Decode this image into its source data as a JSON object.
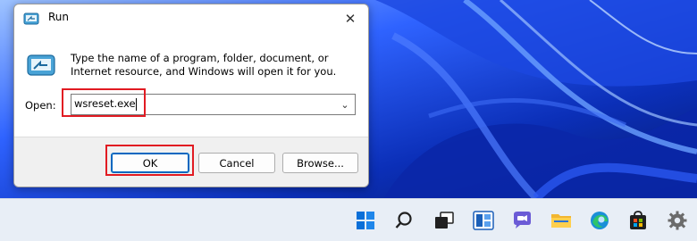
{
  "dialog": {
    "title": "Run",
    "description": "Type the name of a program, folder, document, or Internet resource, and Windows will open it for you.",
    "open_label": "Open:",
    "command_value": "wsreset.exe",
    "buttons": {
      "ok": "OK",
      "cancel": "Cancel",
      "browse": "Browse..."
    }
  },
  "taskbar": {
    "icons": [
      "start-icon",
      "search-icon",
      "task-view-icon",
      "widgets-icon",
      "chat-icon",
      "file-explorer-icon",
      "edge-icon",
      "store-icon",
      "settings-icon"
    ]
  },
  "colors": {
    "highlight": "#e11b22",
    "ok_border": "#0067c0",
    "taskbar_bg": "#e8eef6"
  }
}
